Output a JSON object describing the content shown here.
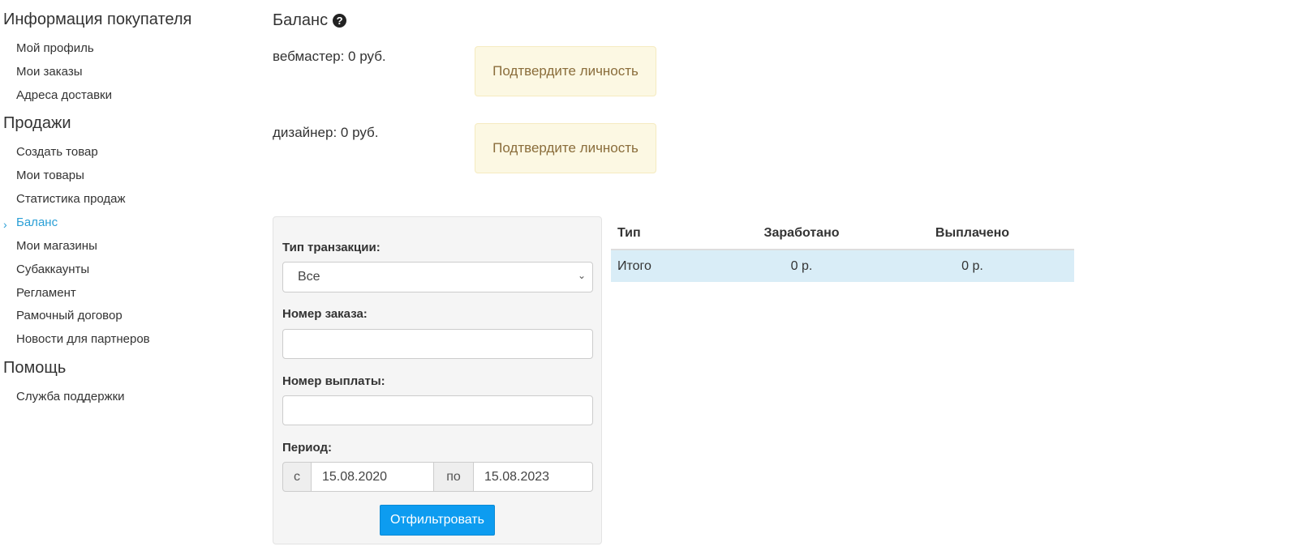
{
  "sidebar": {
    "sections": [
      {
        "title": "Информация покупателя",
        "items": [
          "Мой профиль",
          "Мои заказы",
          "Адреса доставки"
        ]
      },
      {
        "title": "Продажи",
        "items": [
          "Создать товар",
          "Мои товары",
          "Статистика продаж",
          "Баланс",
          "Мои магазины",
          "Субаккаунты",
          "Регламент",
          "Рамочный договор",
          "Новости для партнеров"
        ]
      },
      {
        "title": "Помощь",
        "items": [
          "Служба поддержки"
        ]
      }
    ],
    "active_item": "Баланс"
  },
  "main": {
    "title": "Баланс",
    "help_icon": "question-circle-icon",
    "balances": [
      {
        "text": "вебмастер: 0 руб.",
        "action": "Подтвердите личность"
      },
      {
        "text": "дизайнер: 0 руб.",
        "action": "Подтвердите личность"
      }
    ]
  },
  "filter": {
    "type_label": "Тип транзакции:",
    "type_value": "Все",
    "order_label": "Номер заказа:",
    "order_value": "",
    "payout_label": "Номер выплаты:",
    "payout_value": "",
    "period_label": "Период:",
    "from_label": "с",
    "from_value": "15.08.2020",
    "to_label": "по",
    "to_value": "15.08.2023",
    "submit_label": "Отфильтровать"
  },
  "table": {
    "headers": [
      "Тип",
      "Заработано",
      "Выплачено"
    ],
    "rows": [
      [
        "Итого",
        "0 р.",
        "0 р."
      ]
    ]
  },
  "colors": {
    "accent": "#2a9fd6",
    "button": "#0d9cf0",
    "warning_bg": "#fcf8e3",
    "warning_text": "#8a6d3b",
    "total_row_bg": "#d9edf7"
  }
}
